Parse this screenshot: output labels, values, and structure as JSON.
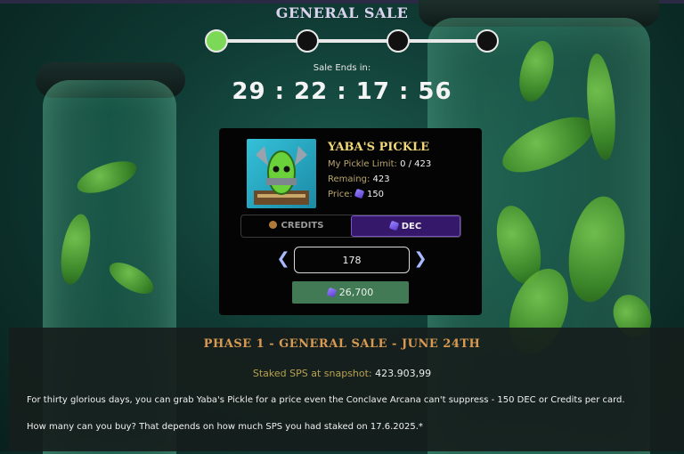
{
  "header": {
    "title": "GENERAL SALE",
    "steps": 4,
    "active_step": 1
  },
  "timer": {
    "label": "Sale Ends in:",
    "countdown": "29 : 22 : 17 : 56"
  },
  "card": {
    "item_name": "YABA'S PICKLE",
    "limit_label": "My Pickle Limit:",
    "limit_value": "0 / 423",
    "remaining_label": "Remaing:",
    "remaining_value": "423",
    "price_label": "Price:",
    "price_value": "150",
    "toggle_credits": "CREDITS",
    "toggle_dec": "DEC",
    "selected_currency": "DEC",
    "quantity": "178",
    "buy_total": "26,700",
    "colors": {
      "accent_dec": "#36186a",
      "buy_button": "#437a56",
      "title_gold": "#f0d87a"
    }
  },
  "phase": {
    "title": "PHASE 1 - GENERAL SALE - JUNE 24TH",
    "staked_label": "Staked SPS at snapshot:",
    "staked_value": "423.903,99",
    "paragraph1": "For thirty glorious days, you can grab Yaba's Pickle for a price even the Conclave Arcana can't suppress - 150 DEC or Credits per card.",
    "paragraph2": "How many can you buy? That depends on how much SPS you had staked on 17.6.2025.*"
  }
}
